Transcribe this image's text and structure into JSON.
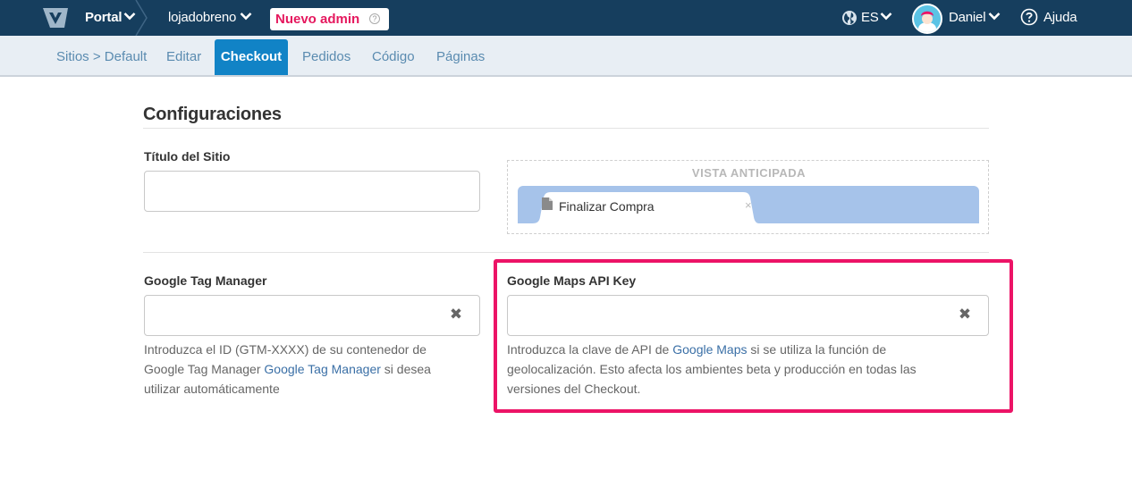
{
  "topbar": {
    "brand": "Portal",
    "store": "lojadobreno",
    "admin_label": "Nuevo admin",
    "admin_help": "?",
    "language": "ES",
    "user": "Daniel",
    "help": "Ajuda",
    "colors": {
      "bar": "#163e5e",
      "admin_text": "#e5185e"
    }
  },
  "tabs": {
    "breadcrumb": "Sitios > Default",
    "items": [
      "Editar",
      "Checkout",
      "Pedidos",
      "Código",
      "Páginas"
    ],
    "active": "Checkout",
    "colors": {
      "active_bg": "#1183c6"
    }
  },
  "main": {
    "section_title": "Configuraciones",
    "site_title": {
      "label": "Título del Sitio",
      "value": ""
    },
    "preview": {
      "title": "VISTA ANTICIPADA",
      "tab_label": "Finalizar Compra",
      "close": "×"
    },
    "gtm": {
      "label": "Google Tag Manager",
      "value": "",
      "clear": "✖",
      "help_before": "Introduzca el ID (GTM-XXXX) de su contenedor de Google Tag Manager ",
      "help_link": "Google Tag Manager",
      "help_after": " si desea utilizar automáticamente"
    },
    "maps": {
      "label": "Google Maps API Key",
      "value": "",
      "clear": "✖",
      "help_before": "Introduzca la clave de API de ",
      "help_link": "Google Maps",
      "help_after": " si se utiliza la función de geolocalización. Esto afecta los ambientes beta y producción en todas las versiones del Checkout."
    },
    "colors": {
      "highlight": "#ec1366",
      "link": "#3a6fa6"
    }
  }
}
